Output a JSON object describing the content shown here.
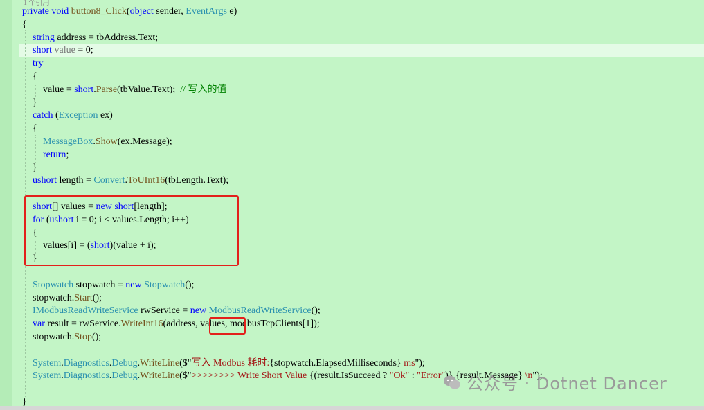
{
  "editor": {
    "references_hint": "1 个引用",
    "lines": [
      {
        "indent": 32,
        "tokens": [
          {
            "c": "kw",
            "t": "private"
          },
          {
            "c": "",
            "t": " "
          },
          {
            "c": "kw",
            "t": "void"
          },
          {
            "c": "",
            "t": " "
          },
          {
            "c": "mt",
            "t": "button8_Click"
          },
          {
            "c": "",
            "t": "("
          },
          {
            "c": "kw",
            "t": "object"
          },
          {
            "c": "",
            "t": " sender, "
          },
          {
            "c": "ty",
            "t": "EventArgs"
          },
          {
            "c": "",
            "t": " e)"
          }
        ]
      },
      {
        "indent": 32,
        "tokens": [
          {
            "c": "",
            "t": "{"
          }
        ]
      },
      {
        "indent": 47,
        "tokens": [
          {
            "c": "kw",
            "t": "string"
          },
          {
            "c": "",
            "t": " address = tbAddress.Text;"
          }
        ]
      },
      {
        "indent": 47,
        "tokens": [
          {
            "c": "kw",
            "t": "short"
          },
          {
            "c": "",
            "t": " "
          },
          {
            "c": "dim",
            "t": "value"
          },
          {
            "c": "",
            "t": " = 0;"
          }
        ]
      },
      {
        "indent": 47,
        "tokens": [
          {
            "c": "kw",
            "t": "try"
          }
        ]
      },
      {
        "indent": 47,
        "tokens": [
          {
            "c": "",
            "t": "{"
          }
        ]
      },
      {
        "indent": 62,
        "tokens": [
          {
            "c": "",
            "t": "value = "
          },
          {
            "c": "kw",
            "t": "short"
          },
          {
            "c": "",
            "t": "."
          },
          {
            "c": "mt",
            "t": "Parse"
          },
          {
            "c": "",
            "t": "(tbValue.Text);  "
          },
          {
            "c": "cm",
            "t": "// 写入的值"
          }
        ]
      },
      {
        "indent": 47,
        "tokens": [
          {
            "c": "",
            "t": "}"
          }
        ]
      },
      {
        "indent": 47,
        "tokens": [
          {
            "c": "kw",
            "t": "catch"
          },
          {
            "c": "",
            "t": " ("
          },
          {
            "c": "ty",
            "t": "Exception"
          },
          {
            "c": "",
            "t": " ex)"
          }
        ]
      },
      {
        "indent": 47,
        "tokens": [
          {
            "c": "",
            "t": "{"
          }
        ]
      },
      {
        "indent": 62,
        "tokens": [
          {
            "c": "ty",
            "t": "MessageBox"
          },
          {
            "c": "",
            "t": "."
          },
          {
            "c": "mt",
            "t": "Show"
          },
          {
            "c": "",
            "t": "(ex.Message);"
          }
        ]
      },
      {
        "indent": 62,
        "tokens": [
          {
            "c": "kw",
            "t": "return"
          },
          {
            "c": "",
            "t": ";"
          }
        ]
      },
      {
        "indent": 47,
        "tokens": [
          {
            "c": "",
            "t": "}"
          }
        ]
      },
      {
        "indent": 47,
        "tokens": [
          {
            "c": "kw",
            "t": "ushort"
          },
          {
            "c": "",
            "t": " length = "
          },
          {
            "c": "ty",
            "t": "Convert"
          },
          {
            "c": "",
            "t": "."
          },
          {
            "c": "mt",
            "t": "ToUInt16"
          },
          {
            "c": "",
            "t": "(tbLength.Text);"
          }
        ]
      },
      {
        "indent": 47,
        "tokens": []
      },
      {
        "indent": 47,
        "tokens": [
          {
            "c": "kw",
            "t": "short"
          },
          {
            "c": "",
            "t": "[] values = "
          },
          {
            "c": "kw",
            "t": "new"
          },
          {
            "c": "",
            "t": " "
          },
          {
            "c": "kw",
            "t": "short"
          },
          {
            "c": "",
            "t": "[length];"
          }
        ]
      },
      {
        "indent": 47,
        "tokens": [
          {
            "c": "kw",
            "t": "for"
          },
          {
            "c": "",
            "t": " ("
          },
          {
            "c": "kw",
            "t": "ushort"
          },
          {
            "c": "",
            "t": " i = 0; i < values.Length; i++)"
          }
        ]
      },
      {
        "indent": 47,
        "tokens": [
          {
            "c": "",
            "t": "{"
          }
        ]
      },
      {
        "indent": 62,
        "tokens": [
          {
            "c": "",
            "t": "values[i] = ("
          },
          {
            "c": "kw",
            "t": "short"
          },
          {
            "c": "",
            "t": ")(value + i);"
          }
        ]
      },
      {
        "indent": 47,
        "tokens": [
          {
            "c": "",
            "t": "}"
          }
        ]
      },
      {
        "indent": 47,
        "tokens": []
      },
      {
        "indent": 47,
        "tokens": [
          {
            "c": "ty",
            "t": "Stopwatch"
          },
          {
            "c": "",
            "t": " stopwatch = "
          },
          {
            "c": "kw",
            "t": "new"
          },
          {
            "c": "",
            "t": " "
          },
          {
            "c": "ty",
            "t": "Stopwatch"
          },
          {
            "c": "",
            "t": "();"
          }
        ]
      },
      {
        "indent": 47,
        "tokens": [
          {
            "c": "",
            "t": "stopwatch."
          },
          {
            "c": "mt",
            "t": "Start"
          },
          {
            "c": "",
            "t": "();"
          }
        ]
      },
      {
        "indent": 47,
        "tokens": [
          {
            "c": "ty",
            "t": "IModbusReadWriteService"
          },
          {
            "c": "",
            "t": " rwService = "
          },
          {
            "c": "kw",
            "t": "new"
          },
          {
            "c": "",
            "t": " "
          },
          {
            "c": "ty",
            "t": "ModbusReadWriteService"
          },
          {
            "c": "",
            "t": "();"
          }
        ]
      },
      {
        "indent": 47,
        "tokens": [
          {
            "c": "kw",
            "t": "var"
          },
          {
            "c": "",
            "t": " result = rwService."
          },
          {
            "c": "mt",
            "t": "WriteInt16"
          },
          {
            "c": "",
            "t": "(address, values, modbusTcpClients[1]);"
          }
        ]
      },
      {
        "indent": 47,
        "tokens": [
          {
            "c": "",
            "t": "stopwatch."
          },
          {
            "c": "mt",
            "t": "Stop"
          },
          {
            "c": "",
            "t": "();"
          }
        ]
      },
      {
        "indent": 47,
        "tokens": []
      },
      {
        "indent": 47,
        "tokens": [
          {
            "c": "ty",
            "t": "System"
          },
          {
            "c": "",
            "t": "."
          },
          {
            "c": "ty",
            "t": "Diagnostics"
          },
          {
            "c": "",
            "t": "."
          },
          {
            "c": "ty",
            "t": "Debug"
          },
          {
            "c": "",
            "t": "."
          },
          {
            "c": "mt",
            "t": "WriteLine"
          },
          {
            "c": "",
            "t": "($\""
          },
          {
            "c": "st",
            "t": "写入 Modbus 耗时:"
          },
          {
            "c": "",
            "t": "{stopwatch.ElapsedMilliseconds}"
          },
          {
            "c": "st",
            "t": " ms"
          },
          {
            "c": "",
            "t": "\");"
          }
        ]
      },
      {
        "indent": 47,
        "tokens": [
          {
            "c": "ty",
            "t": "System"
          },
          {
            "c": "",
            "t": "."
          },
          {
            "c": "ty",
            "t": "Diagnostics"
          },
          {
            "c": "",
            "t": "."
          },
          {
            "c": "ty",
            "t": "Debug"
          },
          {
            "c": "",
            "t": "."
          },
          {
            "c": "mt",
            "t": "WriteLine"
          },
          {
            "c": "",
            "t": "($\""
          },
          {
            "c": "st",
            "t": ">>>>>>>> Write Short Value "
          },
          {
            "c": "",
            "t": "{(result.IsSucceed ? "
          },
          {
            "c": "st",
            "t": "\"Ok\""
          },
          {
            "c": "",
            "t": " : "
          },
          {
            "c": "st",
            "t": "\"Error\""
          },
          {
            "c": "",
            "t": ")} {result.Message}"
          },
          {
            "c": "st",
            "t": " \\n"
          },
          {
            "c": "",
            "t": "\");"
          }
        ]
      },
      {
        "indent": 47,
        "tokens": []
      },
      {
        "indent": 32,
        "tokens": [
          {
            "c": "",
            "t": "}"
          }
        ]
      }
    ]
  },
  "watermark": {
    "text": "公众号 · Dotnet Dancer",
    "icon": "wechat-icon"
  },
  "colors": {
    "background": "#c3f5c6",
    "keyword": "#0000ff",
    "type": "#2b91af",
    "method": "#74531f",
    "comment": "#008000",
    "highlight_box": "#e3201b"
  }
}
